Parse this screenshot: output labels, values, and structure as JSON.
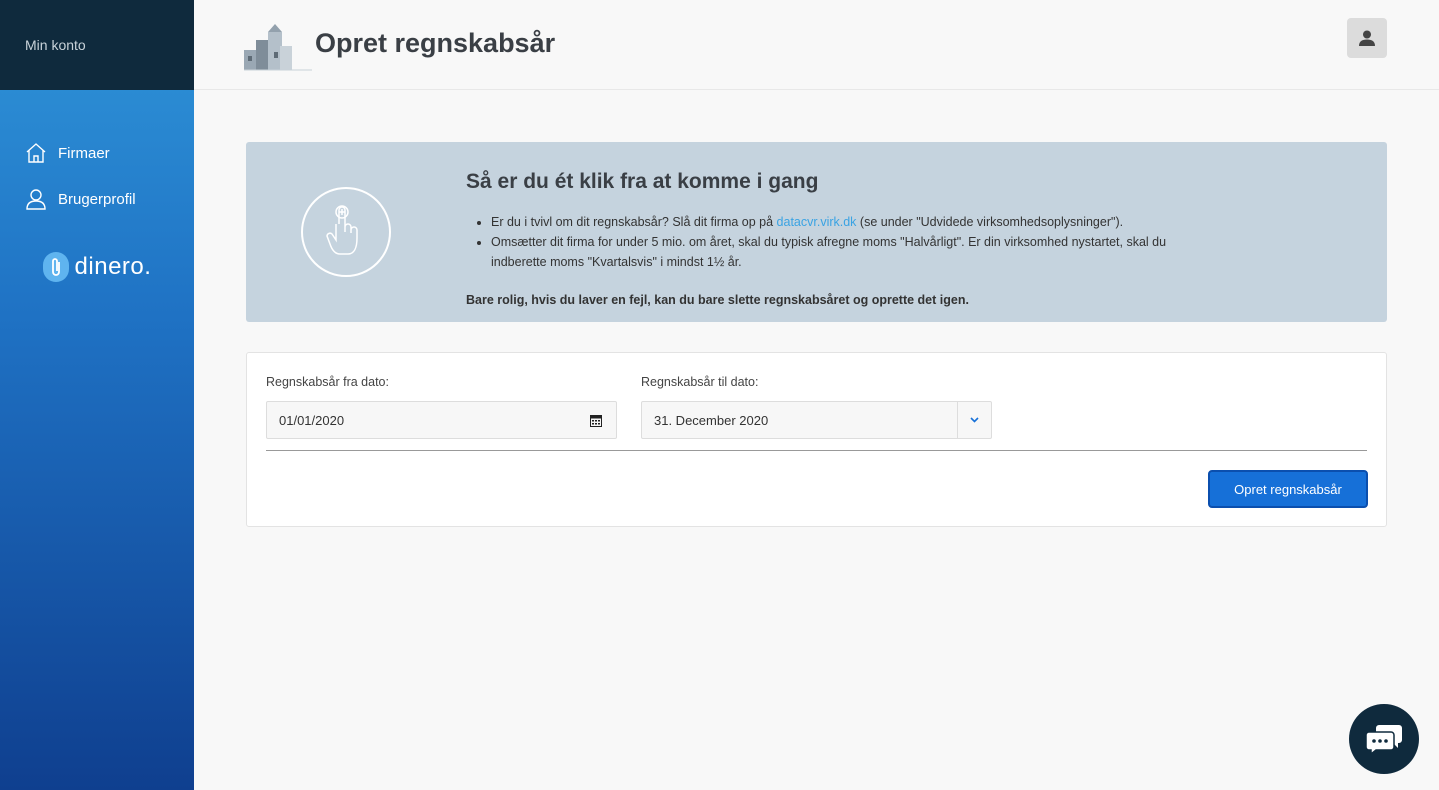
{
  "sidebar": {
    "account_label": "Min konto",
    "items": [
      {
        "label": "Firmaer",
        "icon": "home-icon"
      },
      {
        "label": "Brugerprofil",
        "icon": "user-icon"
      }
    ],
    "brand": "dinero."
  },
  "header": {
    "title": "Opret regnskabsår"
  },
  "banner": {
    "heading": "Så er du ét klik fra at komme i gang",
    "bullet1_pre": "Er du i tvivl om dit regnskabsår? Slå dit firma op på ",
    "bullet1_link": "datacvr.virk.dk",
    "bullet1_post": " (se under \"Udvidede virksomhedsoplysninger\").",
    "bullet2": "Omsætter dit firma for under 5 mio. om året, skal du typisk afregne moms \"Halvårligt\". Er din virksomhed nystartet, skal du indberette moms \"Kvartalsvis\" i mindst 1½ år.",
    "note": "Bare rolig, hvis du laver en fejl, kan du bare slette regnskabsåret og oprette det igen."
  },
  "form": {
    "from_label": "Regnskabsår fra dato:",
    "from_value": "01/01/2020",
    "to_label": "Regnskabsår til dato:",
    "to_value": "31. December 2020",
    "submit_label": "Opret regnskabsår"
  },
  "colors": {
    "accent": "#1670d8",
    "sidebar_dark": "#0f2a3d",
    "banner_bg": "#c5d3de",
    "link": "#3aa3e3"
  }
}
